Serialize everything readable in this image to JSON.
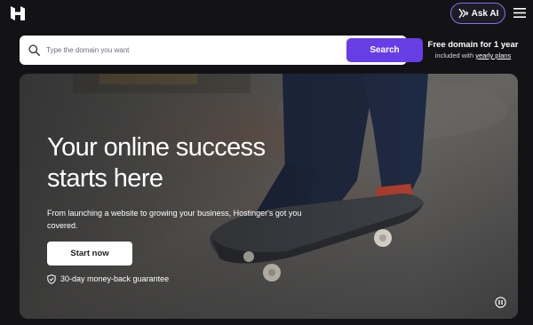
{
  "header": {
    "logo_icon": "hostinger-logo-icon",
    "ask_ai_label": "Ask AI",
    "ask_ai_icon": "sparkle-icon",
    "menu_icon": "hamburger-menu-icon",
    "accent_color": "#8c6cf0"
  },
  "search": {
    "placeholder": "Type the domain you want",
    "value": "",
    "button_label": "Search",
    "icon": "search-icon",
    "button_color": "#673de6"
  },
  "promo": {
    "title": "Free domain for 1 year",
    "subtitle_prefix": "included with",
    "subtitle_link": "yearly plans"
  },
  "hero": {
    "title_line1": "Your online success",
    "title_line2": "starts here",
    "description": "From launching a website to growing your business, Hostinger's got you covered.",
    "cta_label": "Start now",
    "guarantee_text": "30-day money-back guarantee",
    "guarantee_icon": "shield-check-icon",
    "pause_icon": "pause-icon"
  }
}
